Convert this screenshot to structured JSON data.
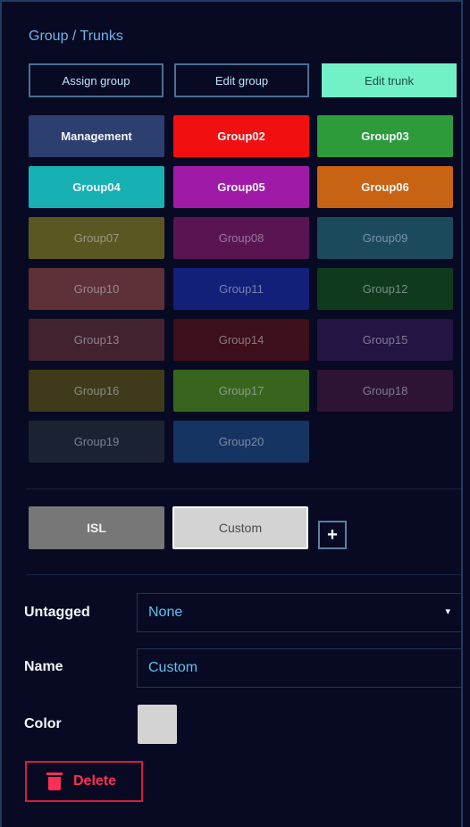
{
  "panel": {
    "title": "Group / Trunks"
  },
  "modes": [
    {
      "label": "Assign group",
      "active": false
    },
    {
      "label": "Edit group",
      "active": false
    },
    {
      "label": "Edit trunk",
      "active": true
    }
  ],
  "groups": [
    {
      "label": "Management",
      "color": "#2c3f6f",
      "dim": false
    },
    {
      "label": "Group02",
      "color": "#f10f0f",
      "dim": false
    },
    {
      "label": "Group03",
      "color": "#2e9b3a",
      "dim": false
    },
    {
      "label": "Group04",
      "color": "#17b1b4",
      "dim": false
    },
    {
      "label": "Group05",
      "color": "#a01aa8",
      "dim": false
    },
    {
      "label": "Group06",
      "color": "#c86314",
      "dim": false
    },
    {
      "label": "Group07",
      "color": "#5b5723",
      "dim": true
    },
    {
      "label": "Group08",
      "color": "#5a1452",
      "dim": true
    },
    {
      "label": "Group09",
      "color": "#1b4a5d",
      "dim": true
    },
    {
      "label": "Group10",
      "color": "#5e3038",
      "dim": true
    },
    {
      "label": "Group11",
      "color": "#12207a",
      "dim": true
    },
    {
      "label": "Group12",
      "color": "#0f3a1d",
      "dim": true
    },
    {
      "label": "Group13",
      "color": "#43222f",
      "dim": true
    },
    {
      "label": "Group14",
      "color": "#3d0f1a",
      "dim": true
    },
    {
      "label": "Group15",
      "color": "#231443",
      "dim": true
    },
    {
      "label": "Group16",
      "color": "#3f3b1a",
      "dim": true
    },
    {
      "label": "Group17",
      "color": "#37651e",
      "dim": true
    },
    {
      "label": "Group18",
      "color": "#2d1336",
      "dim": true
    },
    {
      "label": "Group19",
      "color": "#1b2333",
      "dim": true
    },
    {
      "label": "Group20",
      "color": "#163462",
      "dim": true
    }
  ],
  "trunks": {
    "isl": "ISL",
    "custom": "Custom",
    "add": "+"
  },
  "form": {
    "untagged_label": "Untagged",
    "untagged_value": "None",
    "name_label": "Name",
    "name_value": "Custom",
    "color_label": "Color",
    "color_value": "#d3d3d3",
    "delete_label": "Delete"
  }
}
